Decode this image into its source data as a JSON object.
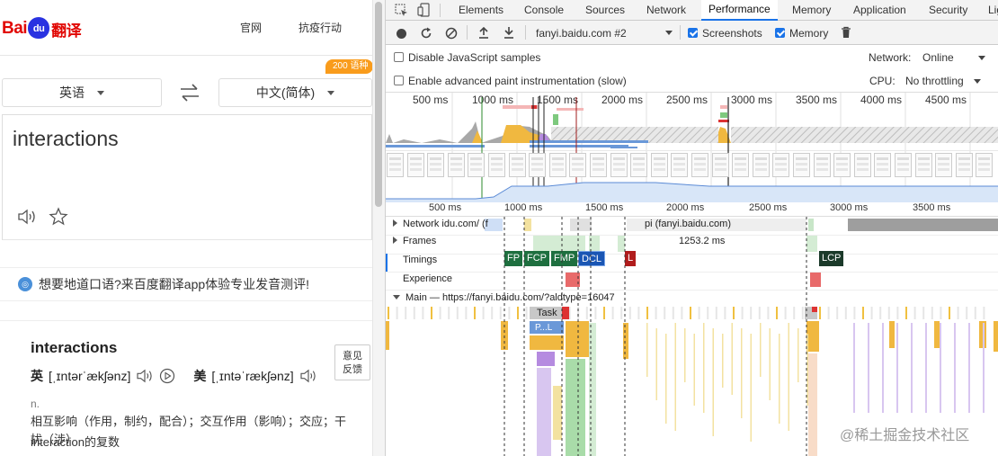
{
  "left": {
    "logo": {
      "bai": "Bai",
      "du": "du",
      "fanyi": "翻译"
    },
    "nav": [
      "官网",
      "抗疫行动"
    ],
    "source_lang": "英语",
    "target_lang": "中文(简体)",
    "badge": "200 语种",
    "input_text": "interactions",
    "promo": "想要地道口语?来百度翻译app体验专业发音测评!",
    "result": {
      "word": "interactions",
      "uk_label": "英",
      "uk_phonetic": "[ˌɪntərˈækʃənz]",
      "us_label": "美",
      "us_phonetic": "[ˌɪntəˈrækʃənz]",
      "pos": "n.",
      "definition": "相互影响（作用，制约，配合）；交互作用（影响）；交应；干扰（涉）",
      "plural": "interaction的复数"
    },
    "feedback": [
      "意见",
      "反馈"
    ]
  },
  "devtools": {
    "tabs": [
      "Elements",
      "Console",
      "Sources",
      "Network",
      "Performance",
      "Memory",
      "Application",
      "Security",
      "Lig"
    ],
    "active_tab": "Performance",
    "toolbar": {
      "target": "fanyi.baidu.com #2",
      "screenshots_label": "Screenshots",
      "memory_label": "Memory",
      "screenshots_checked": true,
      "memory_checked": true
    },
    "settings": {
      "disable_js_samples": "Disable JavaScript samples",
      "advanced_paint": "Enable advanced paint instrumentation (slow)",
      "network_label": "Network:",
      "network_value": "Online",
      "cpu_label": "CPU:",
      "cpu_value": "No throttling"
    },
    "overview_ticks": [
      "500 ms",
      "1000 ms",
      "1500 ms",
      "2000 ms",
      "2500 ms",
      "3000 ms",
      "3500 ms",
      "4000 ms",
      "4500 ms"
    ],
    "detail_ticks": [
      "500 ms",
      "1000 ms",
      "1500 ms",
      "2000 ms",
      "2500 ms",
      "3000 ms",
      "3500 ms"
    ],
    "tracks": {
      "network": "Network",
      "network_row1": "idu.com/ (f",
      "network_row2": "pi (fanyi.baidu.com)",
      "frames": "Frames",
      "frames_value": "1253.2 ms",
      "timings": "Timings",
      "experience": "Experience",
      "main": "Main — https://fanyi.baidu.com/?aldtype=16047"
    },
    "markers": [
      {
        "label": "FP",
        "color": "#1e6f3f"
      },
      {
        "label": "FCP",
        "color": "#1e6f3f"
      },
      {
        "label": "FMP",
        "color": "#1e6f3f"
      },
      {
        "label": "DCL",
        "color": "#1a56b4"
      },
      {
        "label": "L",
        "color": "#b01c1c"
      },
      {
        "label": "LCP",
        "color": "#1b3a2a"
      }
    ],
    "flame": {
      "task": "Task",
      "parse": "P...L"
    }
  },
  "watermark": "@稀土掘金技术社区"
}
